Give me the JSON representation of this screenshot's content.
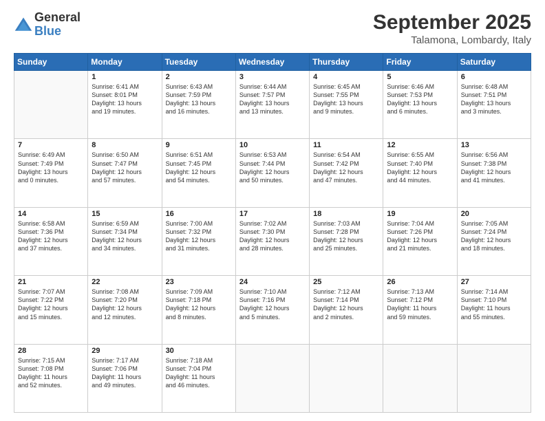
{
  "logo": {
    "general": "General",
    "blue": "Blue"
  },
  "title": "September 2025",
  "subtitle": "Talamona, Lombardy, Italy",
  "days_of_week": [
    "Sunday",
    "Monday",
    "Tuesday",
    "Wednesday",
    "Thursday",
    "Friday",
    "Saturday"
  ],
  "weeks": [
    [
      {
        "day": "",
        "info": ""
      },
      {
        "day": "1",
        "info": "Sunrise: 6:41 AM\nSunset: 8:01 PM\nDaylight: 13 hours\nand 19 minutes."
      },
      {
        "day": "2",
        "info": "Sunrise: 6:43 AM\nSunset: 7:59 PM\nDaylight: 13 hours\nand 16 minutes."
      },
      {
        "day": "3",
        "info": "Sunrise: 6:44 AM\nSunset: 7:57 PM\nDaylight: 13 hours\nand 13 minutes."
      },
      {
        "day": "4",
        "info": "Sunrise: 6:45 AM\nSunset: 7:55 PM\nDaylight: 13 hours\nand 9 minutes."
      },
      {
        "day": "5",
        "info": "Sunrise: 6:46 AM\nSunset: 7:53 PM\nDaylight: 13 hours\nand 6 minutes."
      },
      {
        "day": "6",
        "info": "Sunrise: 6:48 AM\nSunset: 7:51 PM\nDaylight: 13 hours\nand 3 minutes."
      }
    ],
    [
      {
        "day": "7",
        "info": "Sunrise: 6:49 AM\nSunset: 7:49 PM\nDaylight: 13 hours\nand 0 minutes."
      },
      {
        "day": "8",
        "info": "Sunrise: 6:50 AM\nSunset: 7:47 PM\nDaylight: 12 hours\nand 57 minutes."
      },
      {
        "day": "9",
        "info": "Sunrise: 6:51 AM\nSunset: 7:45 PM\nDaylight: 12 hours\nand 54 minutes."
      },
      {
        "day": "10",
        "info": "Sunrise: 6:53 AM\nSunset: 7:44 PM\nDaylight: 12 hours\nand 50 minutes."
      },
      {
        "day": "11",
        "info": "Sunrise: 6:54 AM\nSunset: 7:42 PM\nDaylight: 12 hours\nand 47 minutes."
      },
      {
        "day": "12",
        "info": "Sunrise: 6:55 AM\nSunset: 7:40 PM\nDaylight: 12 hours\nand 44 minutes."
      },
      {
        "day": "13",
        "info": "Sunrise: 6:56 AM\nSunset: 7:38 PM\nDaylight: 12 hours\nand 41 minutes."
      }
    ],
    [
      {
        "day": "14",
        "info": "Sunrise: 6:58 AM\nSunset: 7:36 PM\nDaylight: 12 hours\nand 37 minutes."
      },
      {
        "day": "15",
        "info": "Sunrise: 6:59 AM\nSunset: 7:34 PM\nDaylight: 12 hours\nand 34 minutes."
      },
      {
        "day": "16",
        "info": "Sunrise: 7:00 AM\nSunset: 7:32 PM\nDaylight: 12 hours\nand 31 minutes."
      },
      {
        "day": "17",
        "info": "Sunrise: 7:02 AM\nSunset: 7:30 PM\nDaylight: 12 hours\nand 28 minutes."
      },
      {
        "day": "18",
        "info": "Sunrise: 7:03 AM\nSunset: 7:28 PM\nDaylight: 12 hours\nand 25 minutes."
      },
      {
        "day": "19",
        "info": "Sunrise: 7:04 AM\nSunset: 7:26 PM\nDaylight: 12 hours\nand 21 minutes."
      },
      {
        "day": "20",
        "info": "Sunrise: 7:05 AM\nSunset: 7:24 PM\nDaylight: 12 hours\nand 18 minutes."
      }
    ],
    [
      {
        "day": "21",
        "info": "Sunrise: 7:07 AM\nSunset: 7:22 PM\nDaylight: 12 hours\nand 15 minutes."
      },
      {
        "day": "22",
        "info": "Sunrise: 7:08 AM\nSunset: 7:20 PM\nDaylight: 12 hours\nand 12 minutes."
      },
      {
        "day": "23",
        "info": "Sunrise: 7:09 AM\nSunset: 7:18 PM\nDaylight: 12 hours\nand 8 minutes."
      },
      {
        "day": "24",
        "info": "Sunrise: 7:10 AM\nSunset: 7:16 PM\nDaylight: 12 hours\nand 5 minutes."
      },
      {
        "day": "25",
        "info": "Sunrise: 7:12 AM\nSunset: 7:14 PM\nDaylight: 12 hours\nand 2 minutes."
      },
      {
        "day": "26",
        "info": "Sunrise: 7:13 AM\nSunset: 7:12 PM\nDaylight: 11 hours\nand 59 minutes."
      },
      {
        "day": "27",
        "info": "Sunrise: 7:14 AM\nSunset: 7:10 PM\nDaylight: 11 hours\nand 55 minutes."
      }
    ],
    [
      {
        "day": "28",
        "info": "Sunrise: 7:15 AM\nSunset: 7:08 PM\nDaylight: 11 hours\nand 52 minutes."
      },
      {
        "day": "29",
        "info": "Sunrise: 7:17 AM\nSunset: 7:06 PM\nDaylight: 11 hours\nand 49 minutes."
      },
      {
        "day": "30",
        "info": "Sunrise: 7:18 AM\nSunset: 7:04 PM\nDaylight: 11 hours\nand 46 minutes."
      },
      {
        "day": "",
        "info": ""
      },
      {
        "day": "",
        "info": ""
      },
      {
        "day": "",
        "info": ""
      },
      {
        "day": "",
        "info": ""
      }
    ]
  ]
}
